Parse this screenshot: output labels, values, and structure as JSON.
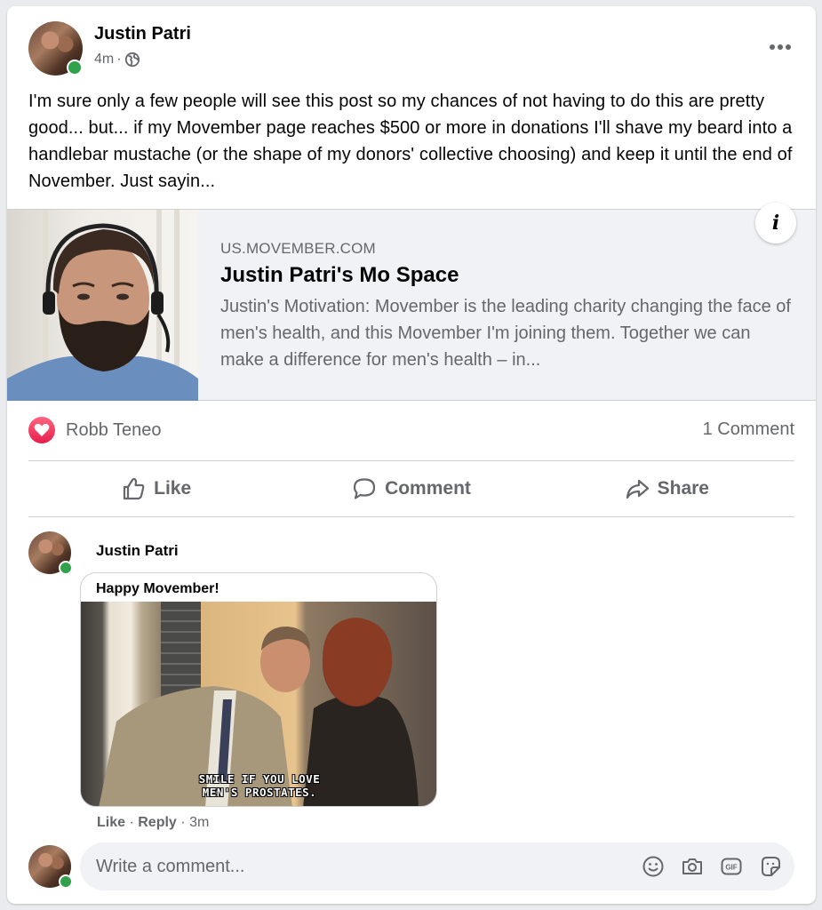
{
  "post": {
    "author": "Justin Patri",
    "time": "4m",
    "separator": "·",
    "text": "I'm sure only a few people will see this post so my chances of not having to do this are pretty good... but... if my Movember page reaches $500 or more in donations I'll shave my beard into a handlebar mustache (or the shape of my donors' collective choosing) and keep it until the end of November. Just sayin...",
    "link": {
      "domain": "US.MOVEMBER.COM",
      "title": "Justin Patri's Mo Space",
      "description": "Justin's Motivation: Movember is the leading charity changing the face of men's health, and this Movember I'm joining them. Together we can make a difference for men's health – in...",
      "info_label": "i"
    },
    "reactions": {
      "names": "Robb Teneo",
      "icon": "love-icon"
    },
    "comment_count": "1 Comment"
  },
  "actions": {
    "like": "Like",
    "comment": "Comment",
    "share": "Share"
  },
  "comment": {
    "author": "Justin Patri",
    "gif_caption": "Happy Movember!",
    "gif_subtitle_line1": "SMILE IF YOU LOVE",
    "gif_subtitle_line2": "MEN'S PROSTATES.",
    "like_label": "Like",
    "reply_label": "Reply",
    "time": "3m",
    "sep": "·"
  },
  "composer": {
    "placeholder": "Write a comment...",
    "icons": [
      "emoji-icon",
      "camera-icon",
      "gif-icon",
      "sticker-icon"
    ],
    "gif_label": "GIF"
  },
  "colors": {
    "online": "#31a24c",
    "secondary_text": "#65676b",
    "love": "#e61e4d"
  }
}
